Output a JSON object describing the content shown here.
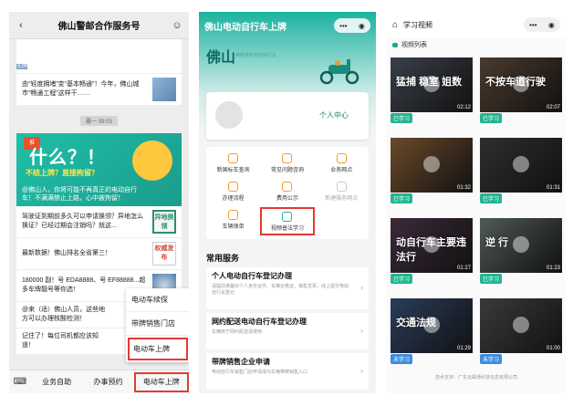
{
  "screen1": {
    "title": "佛山警邮合作服务号",
    "back_icon": "chevron-left-icon",
    "profile_icon": "user-icon",
    "thumb_badge": "无牌",
    "msg1": "由“轻度拥堵”变“基本畅通”！今年，佛山城市“畅通工程”这样干……",
    "time": "晨一 09:03",
    "banner_tag": "推",
    "banner_big": "什么？！",
    "banner_sub": "不结上牌？直接拘留？",
    "banner_desc": "@佛山人，你将可能不再真正的电动自行车！不满满禁止上路，心中被拘留！",
    "msg2": "驾驶证到期前多久可以申请换领？异地怎么换证？已经过期会注销吗？就这...",
    "thumb2": "异地换领",
    "msg3": "最新数据！佛山排名全省第三！",
    "thumb3": "权威发布",
    "msg4": "180000 副！号 EDA8888、号 EF88888...超多车牌靓号等你选！",
    "msg5": "@来（适）佛山人员，这些地方可以办理核酸检测！",
    "msg6": "记住了！每位司机都应该知道！",
    "popup": [
      "电动车续保",
      "带牌销售门店",
      "电动车上牌"
    ],
    "bottom_nav": [
      "业务自助",
      "办事预约",
      "电动车上牌"
    ]
  },
  "screen2": {
    "title": "佛山电动自行车上牌",
    "city": "佛山",
    "city_sub": "美丽富有电动自行车",
    "user_center": "个人中心",
    "grid": [
      {
        "label": "新国标车查询",
        "dim": false,
        "hl": false
      },
      {
        "label": "常见问题咨询",
        "dim": false,
        "hl": false
      },
      {
        "label": "业务网点",
        "dim": false,
        "hl": false
      },
      {
        "label": "办理流程",
        "dim": false,
        "hl": false
      },
      {
        "label": "费用公示",
        "dim": false,
        "hl": false
      },
      {
        "label": "新建服务网点",
        "dim": true,
        "hl": false
      },
      {
        "label": "车辆保单",
        "dim": false,
        "hl": false
      },
      {
        "label": "视频普法学习",
        "dim": false,
        "hl": true
      }
    ],
    "section": "常用服务",
    "services": [
      {
        "title": "个人电动自行车登记办理",
        "desc": "请提前准备好个人身份证件、车辆合格证、销售发票，线上提交电动自行车登记"
      },
      {
        "title": "网约配送电动自行车登记办理",
        "desc": "车辆用于网约配送请使用"
      },
      {
        "title": "带牌销售企业申请",
        "desc": "电动自行车销售门店申请成为车辆带牌销售入口"
      }
    ]
  },
  "screen3": {
    "title": "学习视频",
    "section": "视频列表",
    "videos": [
      {
        "caption": "猛捕 稳室 姐数",
        "dur": "02:12",
        "tag": "已学习",
        "blue": false,
        "bg": "#3a3f48"
      },
      {
        "caption": "不按车道行驶",
        "dur": "02:07",
        "tag": "已学习",
        "blue": false,
        "bg": "#4a3a2e"
      },
      {
        "caption": "",
        "dur": "01:32",
        "tag": "已学习",
        "blue": false,
        "bg": "#6a4a2a"
      },
      {
        "caption": "",
        "dur": "01:31",
        "tag": "已学习",
        "blue": false,
        "bg": "#2e2e30"
      },
      {
        "caption": "动自行车主要违法行",
        "dur": "01:27",
        "tag": "已学习",
        "blue": false,
        "bg": "#3c2a3a"
      },
      {
        "caption": "逆 行",
        "dur": "01:23",
        "tag": "已学习",
        "blue": false,
        "bg": "#505a54"
      },
      {
        "caption": "交通法规",
        "dur": "01:29",
        "tag": "未学习",
        "blue": true,
        "bg": "#2a3d5a"
      },
      {
        "caption": "",
        "dur": "01:00",
        "tag": "未学习",
        "blue": true,
        "bg": "#3a3a3a"
      }
    ],
    "footer": "技术支持：广东云邮通科技信息有限公司"
  },
  "colors": {
    "accent": "#1bb2a0",
    "highlight": "#e53935"
  }
}
